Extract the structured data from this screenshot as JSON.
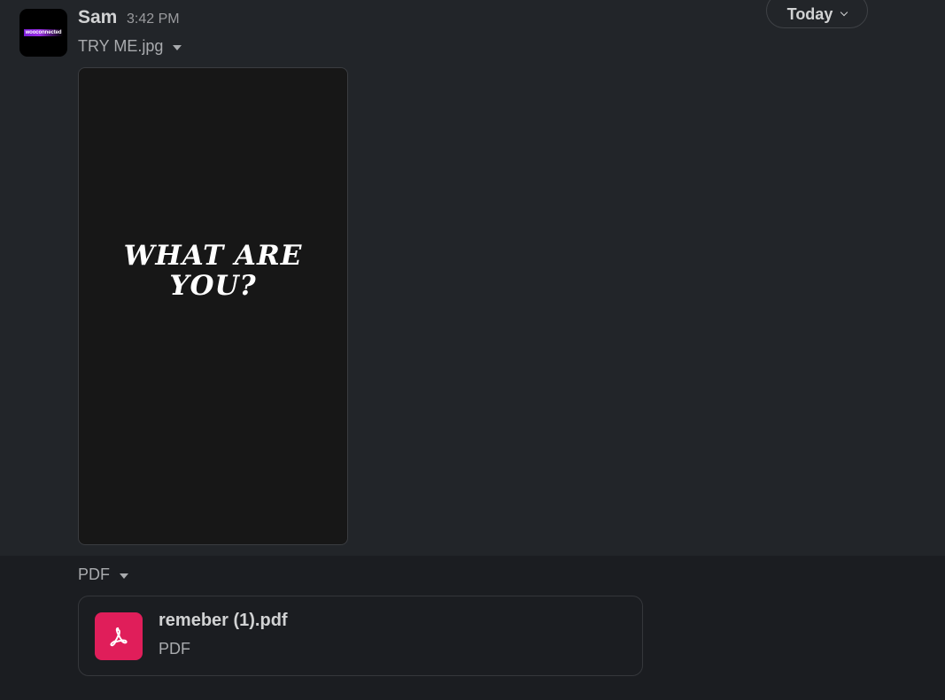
{
  "message": {
    "sender": "Sam",
    "time": "3:42 PM",
    "avatar_logo_text": "wooconnected",
    "image_file": {
      "name": "TRY ME.jpg",
      "image_text_line1": "WHAT ARE",
      "image_text_line2": "YOU?"
    },
    "pdf_file": {
      "group_label": "PDF",
      "name": "remeber (1).pdf",
      "type": "PDF"
    }
  },
  "date_divider": {
    "label": "Today"
  },
  "colors": {
    "background_top": "#222529",
    "background_bottom": "#1b1d21",
    "pdf_icon": "#e01e5a",
    "text_primary": "#d1d2d3",
    "text_secondary": "#a9abae"
  },
  "icons": {
    "pdf": "pdf-icon",
    "caret": "caret-down-icon",
    "chevron": "chevron-down-icon"
  }
}
